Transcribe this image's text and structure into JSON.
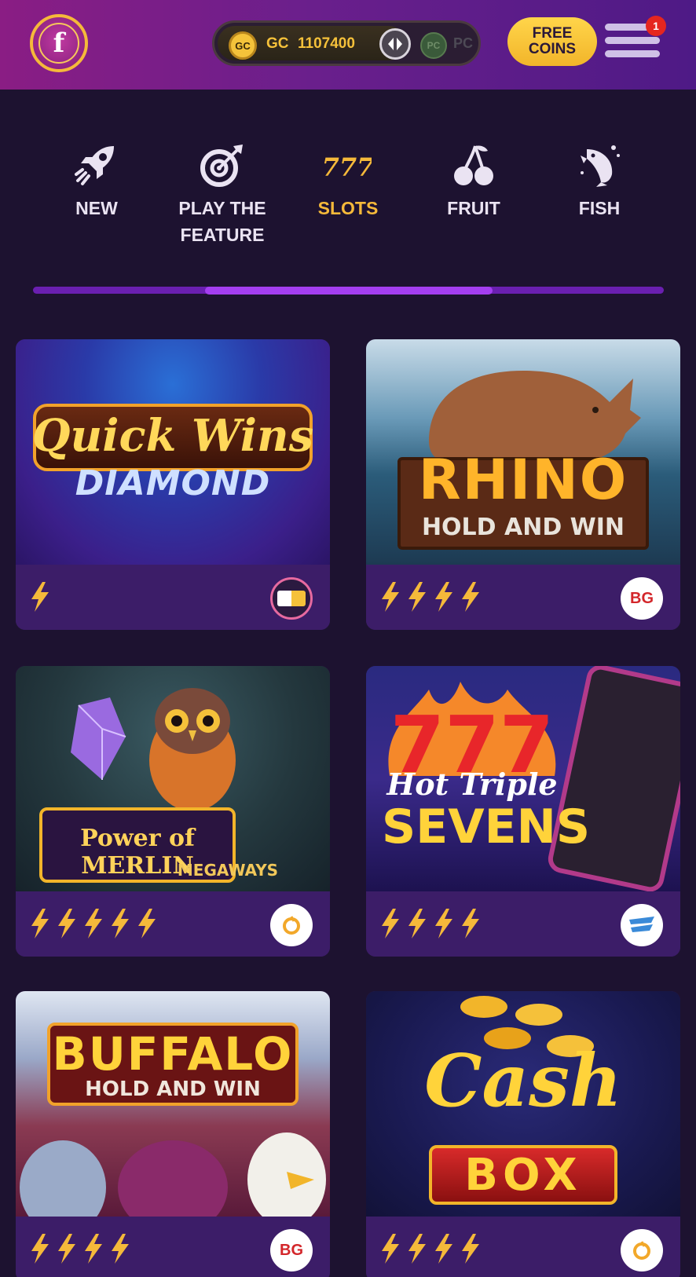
{
  "header": {
    "logo_letter": "f",
    "gc_coin": "GC",
    "gc_label": "GC",
    "gc_amount": "1107400",
    "pc_coin": "PC",
    "pc_label": "PC",
    "free_coins": "FREE\nCOINS",
    "notification_count": "1"
  },
  "categories": [
    {
      "label": "NEW",
      "icon": "rocket-icon"
    },
    {
      "label": "PLAY THE FEATURE",
      "icon": "target-icon"
    },
    {
      "label": "SLOTS",
      "icon": "sevens-icon",
      "active": true
    },
    {
      "label": "FRUIT",
      "icon": "cherries-icon"
    },
    {
      "label": "FISH",
      "icon": "fish-icon"
    }
  ],
  "scroll_indicator": {
    "start": 0.27,
    "end": 0.73
  },
  "games": [
    {
      "title_line1": "Quick Wins",
      "title_line2": "DIAMOND",
      "bolts": 1,
      "provider": ""
    },
    {
      "title_line1": "RHINO",
      "title_line2": "HOLD AND WIN",
      "bolts": 4,
      "provider": "BG"
    },
    {
      "title_line1": "Power of MERLIN",
      "title_line2": "MEGAWAYS",
      "bolts": 5,
      "provider": ""
    },
    {
      "title_line1": "Hot Triple",
      "title_line2": "SEVENS",
      "bolts": 4,
      "provider": ""
    },
    {
      "title_line1": "BUFFALO",
      "title_line2": "HOLD AND WIN",
      "bolts": 4,
      "provider": "BG"
    },
    {
      "title_line1": "Cash",
      "title_line2": "BOX",
      "bolts": 4,
      "provider": ""
    }
  ],
  "colors": {
    "accent": "#f5b93a",
    "background": "#1d1230",
    "card_footer": "#3c1d68",
    "scroll_thumb": "#a43ef0"
  }
}
